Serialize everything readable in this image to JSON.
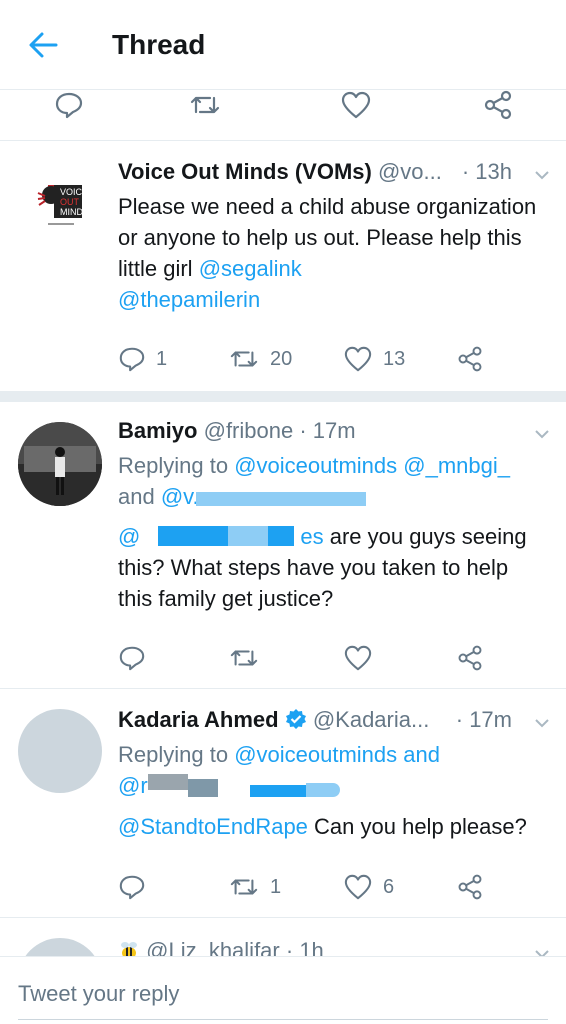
{
  "header": {
    "title": "Thread"
  },
  "colors": {
    "accent": "#1da1f2",
    "muted": "#657786",
    "text": "#14171a",
    "verified": "#1da1f2"
  },
  "tweets": [
    {
      "name": "Voice Out Minds (VOMs)",
      "handle": "@vo...",
      "time": "· 13h",
      "text_plain": "Please we need a child abuse organization or anyone to help us out. Please help this little girl ",
      "mention1": "@segalink",
      "mention2": "@thepamilerin",
      "replies": "1",
      "retweets": "20",
      "likes": "13",
      "logo_text": [
        "VOICE",
        "OUT",
        "MINDS"
      ]
    },
    {
      "name": "Bamiyo",
      "handle": "@fribone",
      "time": "· 17m",
      "replying_prefix": "Replying to ",
      "replying_mentions": "@voiceoutminds @_mnbgi_",
      "replying_and": "and ",
      "replying_partial": "@v...",
      "body_at": "@",
      "body_es": "es",
      "body_text": " are you guys seeing this? What steps have you taken to help this family get justice?"
    },
    {
      "name": "Kadaria Ahmed",
      "handle": "@Kadaria...",
      "time": "· 17m",
      "replying_prefix": "Replying to ",
      "replying_mentions": "@voiceoutminds and",
      "replying_line2": "@r",
      "mention": "@StandtoEndRape",
      "text": " Can you help please?",
      "retweets": "1",
      "likes": "6"
    },
    {
      "handle": "@Liz_khalifar",
      "time": "· 1h"
    }
  ],
  "reply_bar": {
    "placeholder": "Tweet your reply"
  }
}
